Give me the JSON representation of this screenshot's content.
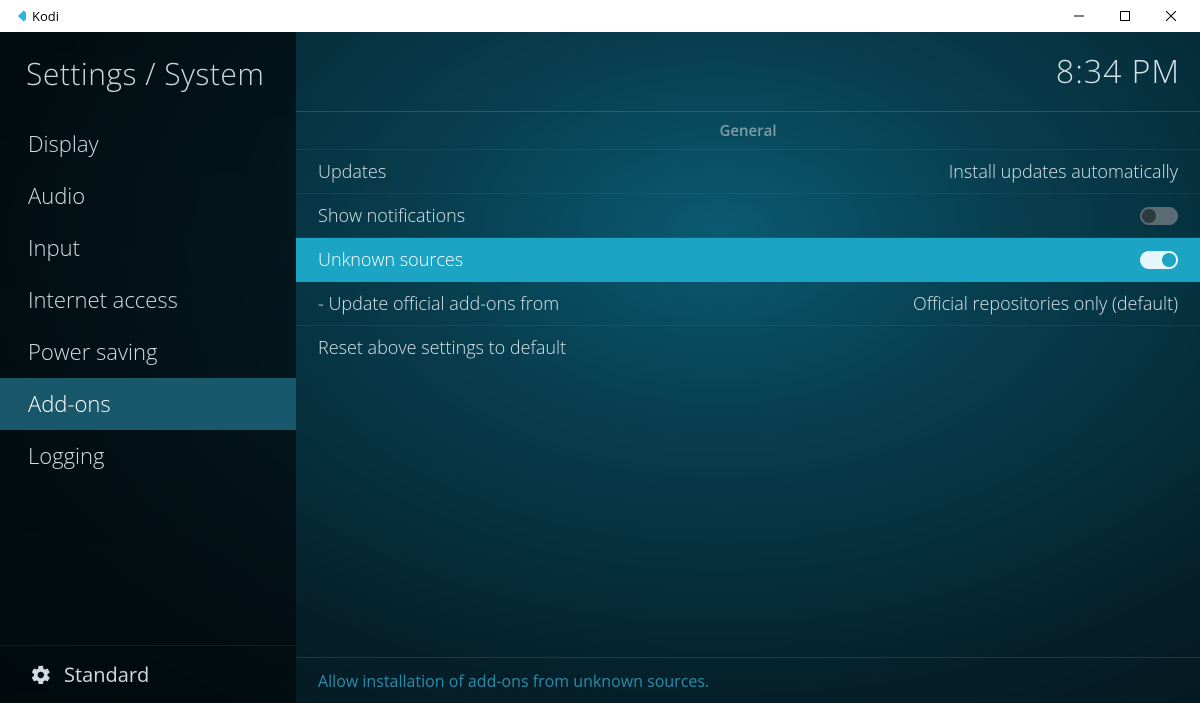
{
  "window": {
    "title": "Kodi"
  },
  "breadcrumb": "Settings / System",
  "clock": "8:34 PM",
  "sidebar": {
    "items": [
      {
        "label": "Display"
      },
      {
        "label": "Audio"
      },
      {
        "label": "Input"
      },
      {
        "label": "Internet access"
      },
      {
        "label": "Power saving"
      },
      {
        "label": "Add-ons"
      },
      {
        "label": "Logging"
      }
    ],
    "selected_index": 5,
    "footer_label": "Standard"
  },
  "section_header": "General",
  "rows": {
    "updates": {
      "label": "Updates",
      "value": "Install updates automatically"
    },
    "show_notifications": {
      "label": "Show notifications",
      "on": false
    },
    "unknown_sources": {
      "label": "Unknown sources",
      "on": true
    },
    "update_addons_from": {
      "label": "- Update official add-ons from",
      "value": "Official repositories only (default)"
    },
    "reset": {
      "label": "Reset above settings to default"
    }
  },
  "selected_row": "unknown_sources",
  "description": "Allow installation of add-ons from unknown sources."
}
